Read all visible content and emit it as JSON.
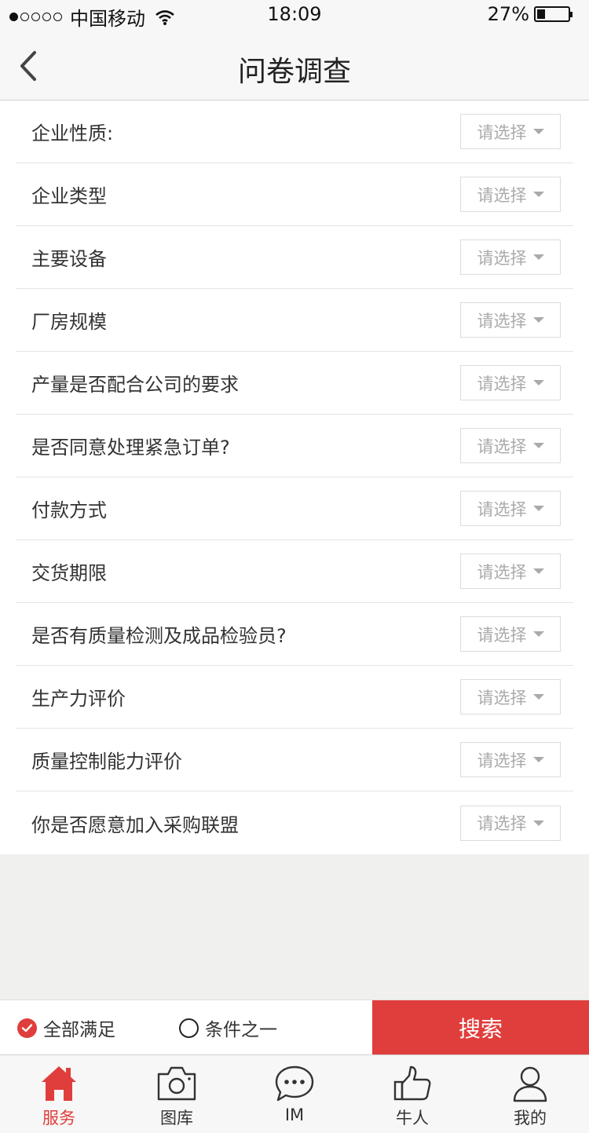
{
  "status": {
    "carrier": "中国移动",
    "time": "18:09",
    "battery": "27%",
    "battery_level": 0.27
  },
  "nav": {
    "title": "问卷调查"
  },
  "questions": [
    {
      "label": "企业性质:",
      "select": "请选择"
    },
    {
      "label": "企业类型",
      "select": "请选择"
    },
    {
      "label": "主要设备",
      "select": "请选择"
    },
    {
      "label": "厂房规模",
      "select": "请选择"
    },
    {
      "label": "产量是否配合公司的要求",
      "select": "请选择"
    },
    {
      "label": "是否同意处理紧急订单?",
      "select": "请选择"
    },
    {
      "label": "付款方式",
      "select": "请选择"
    },
    {
      "label": "交货期限",
      "select": "请选择"
    },
    {
      "label": "是否有质量检测及成品检验员?",
      "select": "请选择"
    },
    {
      "label": "生产力评价",
      "select": "请选择"
    },
    {
      "label": "质量控制能力评价",
      "select": "请选择"
    },
    {
      "label": "你是否愿意加入采购联盟",
      "select": "请选择"
    }
  ],
  "options": {
    "all_label": "全部满足",
    "one_label": "条件之一",
    "search_label": "搜索"
  },
  "tabs": [
    {
      "label": "服务",
      "icon": "home-icon",
      "active": true
    },
    {
      "label": "图库",
      "icon": "camera-icon",
      "active": false
    },
    {
      "label": "IM",
      "icon": "chat-icon",
      "active": false
    },
    {
      "label": "牛人",
      "icon": "thumbs-up-icon",
      "active": false
    },
    {
      "label": "我的",
      "icon": "user-icon",
      "active": false
    }
  ],
  "colors": {
    "accent": "#e03e3c"
  }
}
